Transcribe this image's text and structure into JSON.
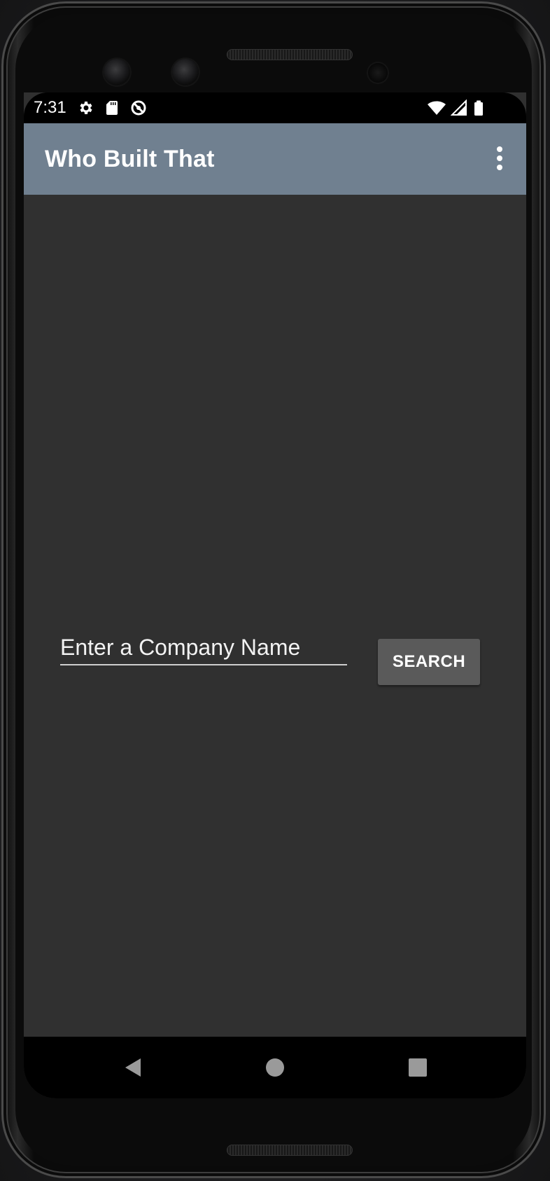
{
  "status_bar": {
    "time": "7:31",
    "left_icons": [
      "gear-icon",
      "sd-card-icon",
      "data-saver-icon"
    ],
    "right_icons": [
      "wifi-icon",
      "cell-signal-icon",
      "battery-icon"
    ]
  },
  "app_bar": {
    "title": "Who Built That",
    "background_color": "#708090",
    "menu_icon": "overflow-menu-icon"
  },
  "main": {
    "company_input": {
      "value": "",
      "placeholder": "Enter a Company Name"
    },
    "search_button": {
      "label": "SEARCH",
      "color": "#5a5a5a"
    }
  },
  "nav_bar": {
    "buttons": [
      "back-icon",
      "home-icon",
      "recents-icon"
    ]
  },
  "colors": {
    "screen_background": "#303030",
    "text": "#ffffff"
  }
}
